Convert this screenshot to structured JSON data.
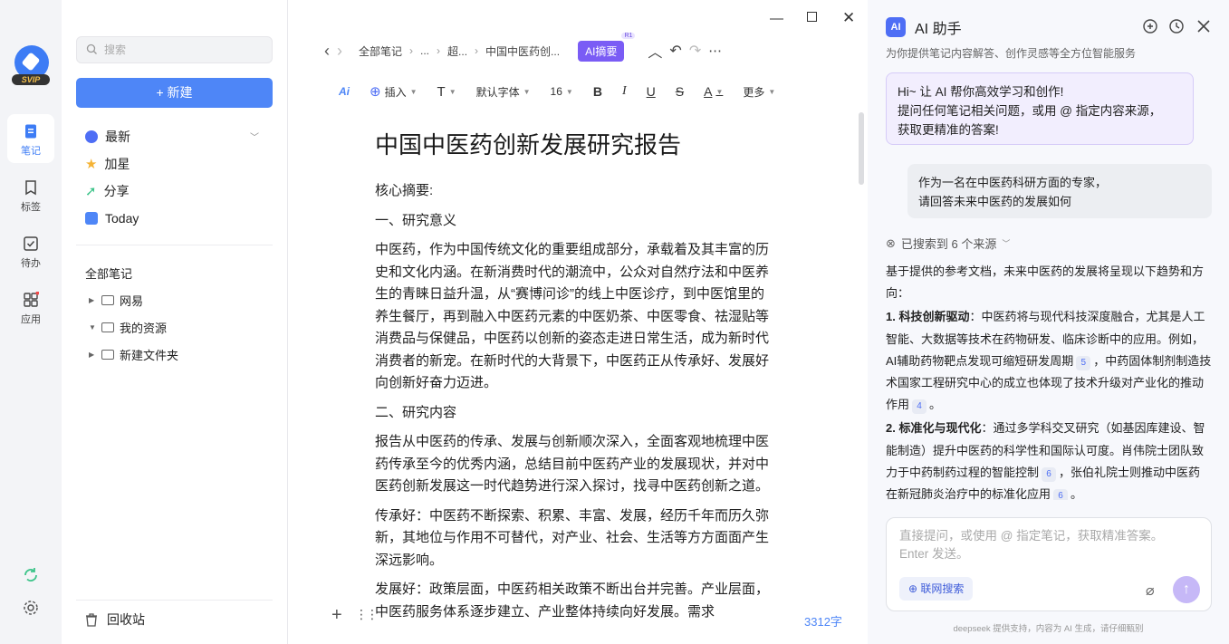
{
  "rail": {
    "badge": "SVIP",
    "items": [
      {
        "label": "笔记",
        "icon": "note-icon"
      },
      {
        "label": "标签",
        "icon": "tag-icon"
      },
      {
        "label": "待办",
        "icon": "todo-icon"
      },
      {
        "label": "应用",
        "icon": "apps-icon"
      }
    ]
  },
  "sidebar": {
    "search_placeholder": "搜索",
    "new_button": "+ 新建",
    "nav": [
      {
        "label": "最新",
        "icon": "clock-icon"
      },
      {
        "label": "加星",
        "icon": "star-icon"
      },
      {
        "label": "分享",
        "icon": "share-icon"
      },
      {
        "label": "Today",
        "icon": "today-icon"
      }
    ],
    "section_title": "全部笔记",
    "folders": [
      "网易",
      "我的资源",
      "新建文件夹"
    ],
    "trash": "回收站"
  },
  "editor": {
    "breadcrumb": [
      "全部笔记",
      "...",
      "超...",
      "中国中医药创..."
    ],
    "ai_summary": "AI摘要",
    "ai_summary_badge": "R1",
    "toolbar": {
      "insert": "插入",
      "font": "默认字体",
      "size": "16",
      "more": "更多"
    },
    "title": "中国中医药创新发展研究报告",
    "paragraphs": [
      "核心摘要:",
      "一、研究意义",
      "中医药，作为中国传统文化的重要组成部分，承载着及其丰富的历史和文化内涵。在新消费时代的潮流中，公众对自然疗法和中医养生的青睐日益升温，从“赛博问诊”的线上中医诊疗，到中医馆里的养生餐厅，再到融入中医药元素的中医奶茶、中医零食、祛湿贴等消费品与保健品，中医药以创新的姿态走进日常生活，成为新时代消费者的新宠。在新时代的大背景下，中医药正从传承好、发展好向创新好奋力迈进。",
      "二、研究内容",
      "报告从中医药的传承、发展与创新顺次深入，全面客观地梳理中医药传承至今的优秀内涵，总结目前中医药产业的发展现状，并对中医药创新发展这一时代趋势进行深入探讨，找寻中医药创新之道。",
      "传承好：中医药不断探索、积累、丰富、发展，经历千年而历久弥新，其地位与作用不可替代，对产业、社会、生活等方方面面产生深远影响。",
      "发展好：政策层面，中医药相关政策不断出台并完善。产业层面，中医药服务体系逐步建立、产业整体持续向好发展。需求"
    ],
    "word_count": "3312字"
  },
  "ai_panel": {
    "title": "AI 助手",
    "subtitle": "为你提供笔记内容解答、创作灵感等全方位智能服务",
    "welcome": [
      "Hi~ 让 AI 帮你高效学习和创作!",
      "提问任何笔记相关问题，或用 @ 指定内容来源，",
      "获取更精准的答案!"
    ],
    "user_question": [
      "作为一名在中医药科研方面的专家，",
      "请回答未来中医药的发展如何"
    ],
    "searched": "已搜索到 6 个来源",
    "answer_intro": "基于提供的参考文档，未来中医药的发展将呈现以下趋势和方向：",
    "points": [
      {
        "heading": "1. 科技创新驱动",
        "text_a": "：中医药将与现代科技深度融合，尤其是人工智能、大数据等技术在药物研发、临床诊断中的应用。例如，AI辅助药物靶点发现可缩短研发周期",
        "ref_a": "5",
        "text_b": "，中药固体制剂制造技术国家工程研究中心的成立也体现了技术升级对产业化的推动作用",
        "ref_b": "4",
        "text_c": "。"
      },
      {
        "heading": "2. 标准化与现代化",
        "text_a": "：通过多学科交叉研究（如基因库建设、智能制造）提升中医药的科学性和国际认可度。肖伟院士团队致力于中药制药过程的智能控制",
        "ref_a": "6",
        "text_b": "，张伯礼院士则推动中医药在新冠肺炎治疗中的标准化应用",
        "ref_b": "6",
        "text_c": "。"
      }
    ],
    "input_placeholder": "直接提问，或使用 @ 指定笔记，获取精准答案。Enter 发送。",
    "web_search": "联网搜索",
    "footer": "deepseek 提供支持，内容为 AI 生成，请仔细甄别"
  }
}
